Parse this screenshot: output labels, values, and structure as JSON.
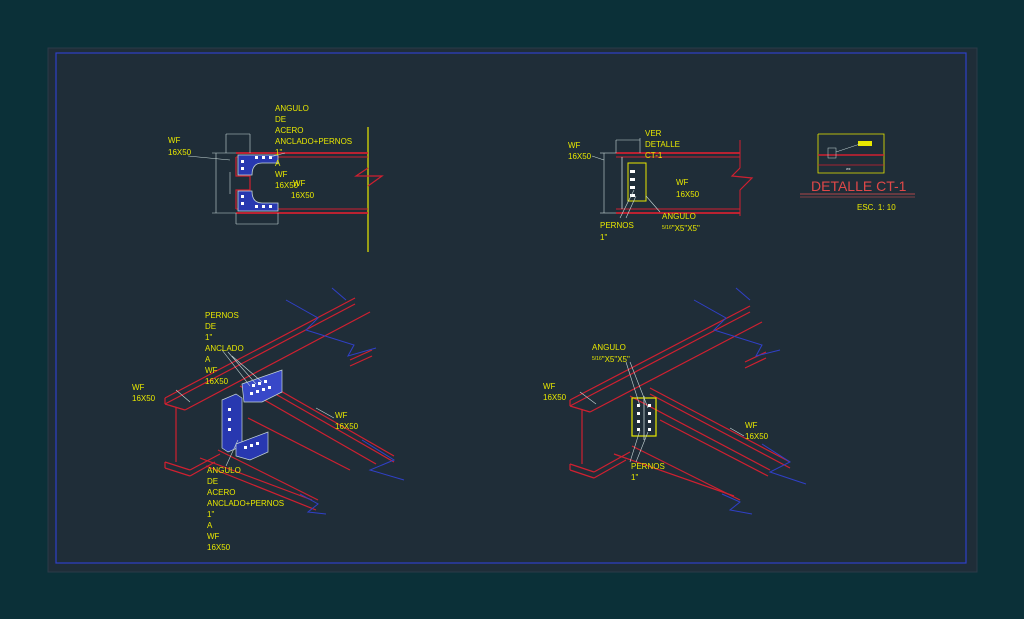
{
  "colors": {
    "background": "#0b3038",
    "drawing_area": "#1f2d38",
    "frame": "#3040c8",
    "beam": "#d02030",
    "text": "#e8e800",
    "title": "#e05050",
    "dimension": "#c8d8d8",
    "plate": "#2838b0",
    "bolt": "#ffffff"
  },
  "labels": {
    "wf": "WF",
    "wf_size": "16X50",
    "angulo": "ANGULO",
    "de": "DE",
    "acero": "ACERO",
    "anclado_pernos": "ANCLADO+PERNOS",
    "one_inch": "1\"",
    "a": "A",
    "pernos": "PERNOS",
    "anclado": "ANCLADO",
    "ver": "VER",
    "detalle": "DETALLE",
    "ct1": "CT-1",
    "angle_size_frac": "5/16",
    "angle_size_rest": "\"X5\"X5\""
  },
  "title": {
    "main": "DETALLE CT-1",
    "scale": "ESC. 1: 10"
  },
  "icons": [
    "bolt-icon",
    "break-line-icon"
  ]
}
